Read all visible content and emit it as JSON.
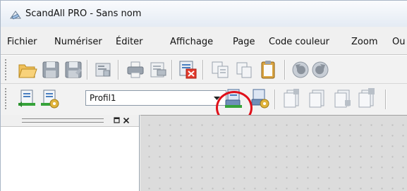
{
  "window": {
    "title": "ScandAll PRO - Sans nom"
  },
  "menu": {
    "items": [
      "Fichier",
      "Numériser",
      "Éditer",
      "Affichage",
      "Page",
      "Code couleur",
      "Zoom",
      "Ou"
    ]
  },
  "toolbar1": {
    "buttons": [
      "open-folder",
      "save",
      "save-as",
      "properties",
      "print",
      "print-preview",
      "delete",
      "copy",
      "paste",
      "clipboard",
      "undo",
      "redo"
    ]
  },
  "toolbar2": {
    "profile_value": "Profil1",
    "buttons": [
      "scan-to-file",
      "scan-settings",
      "scan-with-profile",
      "profile-settings",
      "page-insert",
      "page-replace",
      "page-append",
      "page-delete"
    ]
  },
  "annotation": {
    "highlight_target": "scan-with-profile-button",
    "color": "#e0101a"
  }
}
